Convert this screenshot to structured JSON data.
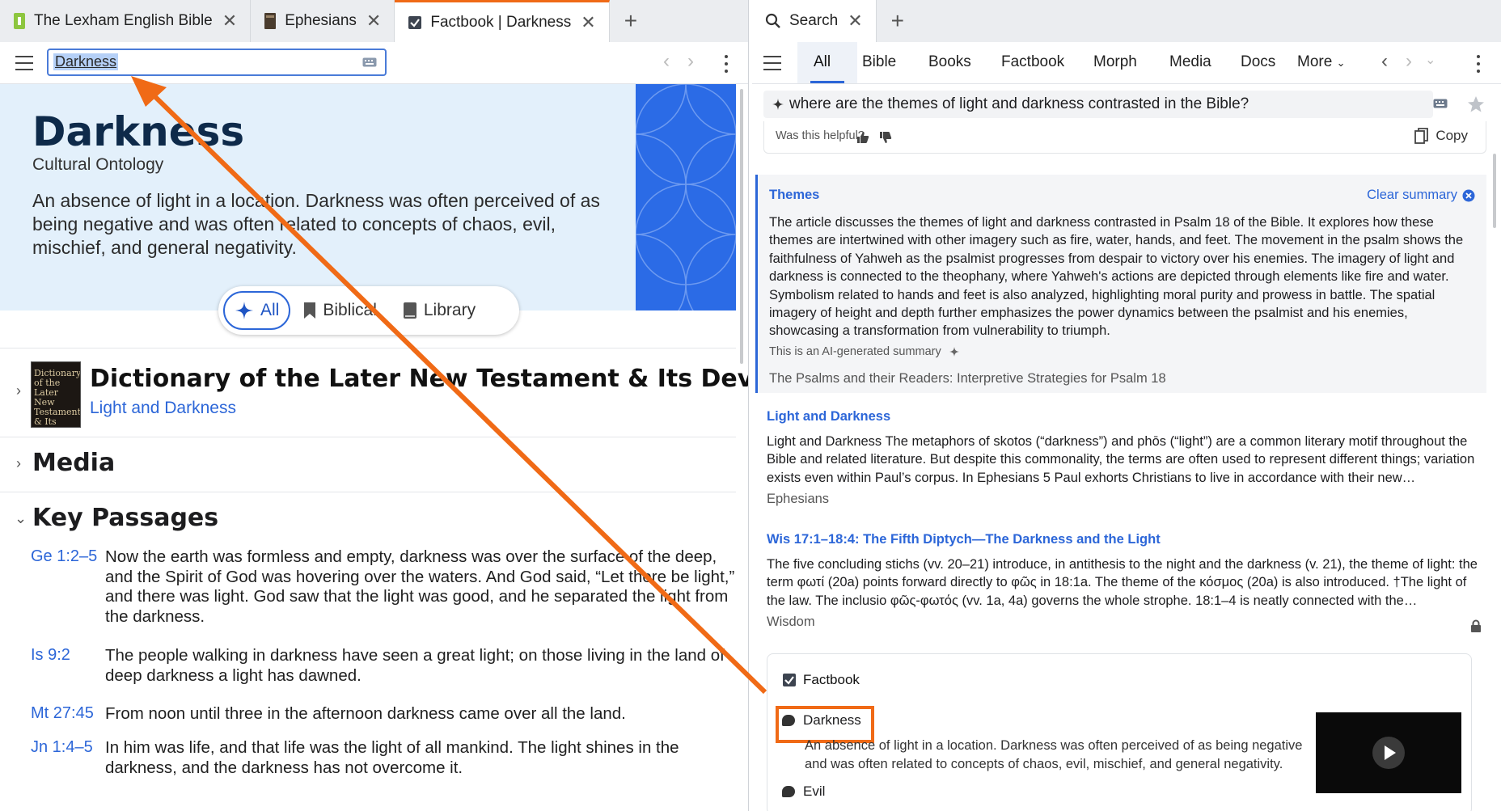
{
  "left": {
    "tabs": [
      {
        "label": "The Lexham English Bible",
        "icon": "bible-icon",
        "color": "#8dc63f"
      },
      {
        "label": "Ephesians",
        "icon": "book-icon",
        "color": "#5a4a3a"
      },
      {
        "label": "Factbook | Darkness",
        "icon": "factbook-icon",
        "color": "#333333"
      }
    ],
    "search_value": "Darkness",
    "hero": {
      "title": "Darkness",
      "subtitle": "Cultural Ontology",
      "description": "An absence of light in a location. Darkness was often perceived of as being negative and was often related to concepts of chaos, evil, mischief, and general negativity."
    },
    "filters": [
      "All",
      "Biblical",
      "Library"
    ],
    "dictionary": {
      "title": "Dictionary of the Later New Testament & Its Devel...",
      "link": "Light and Darkness",
      "cover_text": "Dictionary of the Later New Testament & Its Developments"
    },
    "media_title": "Media",
    "key_passages": {
      "title": "Key Passages",
      "items": [
        {
          "ref": "Ge 1:2–5",
          "text": "Now the earth was formless and empty, darkness was over the surface of the deep, and the Spirit of God was hovering over the waters. And God said, “Let there be light,” and there was light. God saw that the light was good, and he separated the light from the darkness."
        },
        {
          "ref": "Is 9:2",
          "text": "The people walking in darkness have seen a great light; on those living in the land of deep darkness a light has dawned."
        },
        {
          "ref": "Mt 27:45",
          "text": "From noon until three in the afternoon darkness came over all the land."
        },
        {
          "ref": "Jn 1:4–5",
          "text": "In him was life, and that life was the light of all mankind. The light shines in the darkness, and the darkness has not overcome it."
        }
      ]
    }
  },
  "right": {
    "tab_label": "Search",
    "nav_tabs": [
      "All",
      "Bible",
      "Books",
      "Factbook",
      "Morph",
      "Media",
      "Docs",
      "More"
    ],
    "query": "where are the themes of light and darkness contrasted in the Bible?",
    "helpful_label": "Was this helpful?",
    "copy_label": "Copy",
    "summary": {
      "heading": "Themes",
      "clear_label": "Clear summary",
      "body": "The article discusses the themes of light and darkness contrasted in Psalm 18 of the Bible. It explores how these themes are intertwined with other imagery such as fire, water, hands, and feet. The movement in the psalm shows the faithfulness of Yahweh as the psalmist progresses from despair to victory over his enemies. The imagery of light and darkness is connected to the theophany, where Yahweh's actions are depicted through elements like fire and water. Symbolism related to hands and feet is also analyzed, highlighting moral purity and prowess in battle. The spatial imagery of height and depth further emphasizes the power dynamics between the psalmist and his enemies, showcasing a transformation from vulnerability to triumph.",
      "ai_note": "This is an AI-generated summary",
      "source": "The Psalms and their Readers: Interpretive Strategies for Psalm 18"
    },
    "results": [
      {
        "title": "Light and Darkness",
        "body": "Light and Darkness The metaphors of skotos (“darkness”) and phōs (“light”) are a common literary motif throughout the Bible and related literature. But despite this commonality, the terms are often used to represent different things; variation exists even within Paul’s corpus. In Ephesians 5 Paul exhorts Christians to live in accordance with their new…",
        "source": "Ephesians"
      },
      {
        "title": "Wis 17:1–18:4: The Fifth Diptych—The Darkness and the Light",
        "body": "The five concluding stichs (vv. 20–21) introduce, in antithesis to the night and the darkness (v. 21), the theme of light: the term φωτί (20a) points forward directly to φῶς in 18:1a. The theme of the κόσμος (20a) is also introduced. †The light of the law. The inclusio φῶς-φωτός (vv. 1a, 4a) governs the whole strophe. 18:1–4 is neatly connected with the…",
        "source": "Wisdom"
      }
    ],
    "factbook": {
      "header": "Factbook",
      "items": [
        {
          "label": "Darkness",
          "desc": "An absence of light in a location. Darkness was often perceived of as being negative and was often related to concepts of chaos, evil, mischief, and general negativity."
        },
        {
          "label": "Evil"
        }
      ]
    }
  },
  "colors": {
    "accent": "#2c66d8",
    "annotation": "#f06a16",
    "hero_bg": "#e3f0fb",
    "pattern": "#2b6be6"
  }
}
